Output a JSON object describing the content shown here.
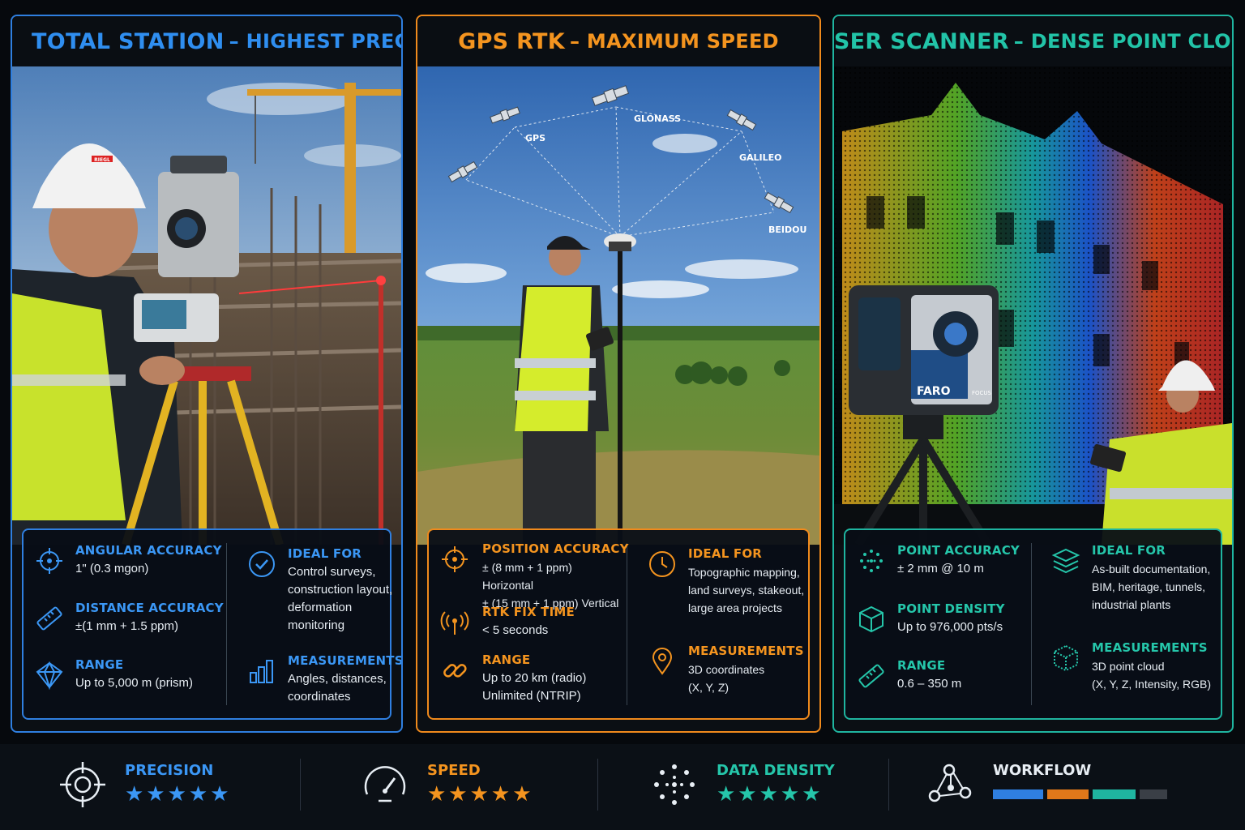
{
  "colors": {
    "total_station": "#2f8ef0",
    "gps_rtk": "#f4941f",
    "laser_scanner": "#22c4a8",
    "inactive": "#3a3f46"
  },
  "panels": [
    {
      "title": "TOTAL STATION",
      "subtitle": "– HIGHEST PRECISION",
      "photo_text": {
        "helmet_brand": "RIEGL"
      },
      "left": [
        {
          "icon": "crosshair-icon",
          "label": "ANGULAR ACCURACY",
          "value": "1\" (0.3 mgon)"
        },
        {
          "icon": "ruler-icon",
          "label": "DISTANCE ACCURACY",
          "value": "±(1 mm + 1.5 ppm)"
        },
        {
          "icon": "prism-icon",
          "label": "RANGE",
          "value": "Up to 5,000 m (prism)"
        }
      ],
      "right": [
        {
          "icon": "checkmark-circle-icon",
          "label": "IDEAL FOR",
          "value": "Control surveys, construction layout, deformation monitoring"
        },
        {
          "icon": "bar-chart-icon",
          "label": "MEASUREMENTS",
          "value": "Angles, distances, coordinates"
        }
      ]
    },
    {
      "title": "GPS RTK",
      "subtitle": "– MAXIMUM SPEED",
      "satellites": [
        "GPS",
        "GLONASS",
        "GALILEO",
        "BEIDOU"
      ],
      "left": [
        {
          "icon": "crosshair-icon",
          "label": "POSITION ACCURACY",
          "value": "± (8 mm + 1 ppm) Horizontal\n± (15 mm + 1 ppm) Vertical"
        },
        {
          "icon": "signal-antenna-icon",
          "label": "RTK FIX TIME",
          "value": "< 5 seconds"
        },
        {
          "icon": "link-icon",
          "label": "RANGE",
          "value": "Up to 20 km (radio)\nUnlimited (NTRIP)"
        }
      ],
      "right": [
        {
          "icon": "clock-icon",
          "label": "IDEAL FOR",
          "value": "Topographic mapping, land surveys, stakeout, large area projects"
        },
        {
          "icon": "location-pin-icon",
          "label": "MEASUREMENTS",
          "value": "3D coordinates\n(X, Y, Z)"
        }
      ]
    },
    {
      "title": "LASER SCANNER",
      "subtitle": "– DENSE POINT CLOUD",
      "scanner_labels": {
        "brand": "FARO",
        "model": "FOCUS"
      },
      "left": [
        {
          "icon": "dot-cluster-icon",
          "label": "POINT ACCURACY",
          "value": "± 2 mm @ 10 m"
        },
        {
          "icon": "cube-icon",
          "label": "POINT DENSITY",
          "value": "Up to 976,000 pts/s"
        },
        {
          "icon": "ruler-icon",
          "label": "RANGE",
          "value": "0.6 – 350 m"
        }
      ],
      "right": [
        {
          "icon": "layers-icon",
          "label": "IDEAL FOR",
          "value": "As-built documentation, BIM, heritage, tunnels, industrial plants"
        },
        {
          "icon": "dotted-cube-icon",
          "label": "MEASUREMENTS",
          "value": "3D point cloud\n(X, Y, Z, Intensity, RGB)"
        }
      ]
    }
  ],
  "ratings": [
    {
      "icon": "target-icon",
      "label": "PRECISION",
      "stars": "★★★★★",
      "color": "#2f8ef0",
      "rating": 5
    },
    {
      "icon": "speedometer-icon",
      "label": "SPEED",
      "stars": "★★★★★",
      "color": "#f4941f",
      "rating": 5
    },
    {
      "icon": "dot-cluster-icon",
      "label": "DATA DENSITY",
      "stars": "★★★★★",
      "color": "#22c4a8",
      "rating": 5
    },
    {
      "icon": "workflow-nodes-icon",
      "label": "WORKFLOW",
      "color": "#e8eef4",
      "segments": [
        {
          "color": "#2f7fe0"
        },
        {
          "color": "#e0781a"
        },
        {
          "color": "#1fb5a0"
        },
        {
          "color": "#3a3f46"
        }
      ]
    }
  ]
}
